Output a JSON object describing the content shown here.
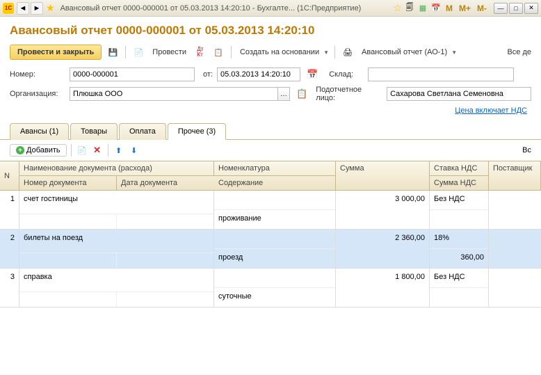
{
  "titlebar": {
    "text": "Авансовый отчет 0000-000001 от 05.03.2013 14:20:10 - Бухгалте... (1С:Предприятие)",
    "icon_text": "1C"
  },
  "header": {
    "title": "Авансовый отчет 0000-000001 от 05.03.2013 14:20:10"
  },
  "toolbar": {
    "save_close": "Провести и закрыть",
    "post": "Провести",
    "create_base": "Создать на основании",
    "print": "Авансовый отчет (АО-1)",
    "all_actions": "Все де"
  },
  "form": {
    "number_label": "Номер:",
    "number_value": "0000-000001",
    "date_label": "от:",
    "date_value": "05.03.2013 14:20:10",
    "stock_label": "Склад:",
    "stock_value": "",
    "org_label": "Организация:",
    "org_value": "Плюшка ООО",
    "person_label": "Подотчетное лицо:",
    "person_value": "Сахарова Светлана Семеновна",
    "vat_link": "Цена включает НДС"
  },
  "tabs": [
    {
      "label": "Авансы (1)"
    },
    {
      "label": "Товары"
    },
    {
      "label": "Оплата"
    },
    {
      "label": "Прочее (3)"
    }
  ],
  "table_toolbar": {
    "add": "Добавить",
    "all": "Вс"
  },
  "grid_headers": {
    "n": "N",
    "doc_name": "Наименование документа (расхода)",
    "doc_num": "Номер документа",
    "doc_date": "Дата документа",
    "nomen": "Номенклатура",
    "content": "Содержание",
    "sum": "Сумма",
    "vat_rate": "Ставка НДС",
    "vat_sum": "Сумма НДС",
    "supplier": "Поставщик"
  },
  "rows": [
    {
      "n": "1",
      "doc_name": "счет гостиницы",
      "content": "проживание",
      "sum": "3 000,00",
      "vat_rate": "Без НДС",
      "vat_sum": ""
    },
    {
      "n": "2",
      "doc_name": "билеты на поезд",
      "content": "проезд",
      "sum": "2 360,00",
      "vat_rate": "18%",
      "vat_sum": "360,00"
    },
    {
      "n": "3",
      "doc_name": "справка",
      "content": "суточные",
      "sum": "1 800,00",
      "vat_rate": "Без НДС",
      "vat_sum": ""
    }
  ]
}
